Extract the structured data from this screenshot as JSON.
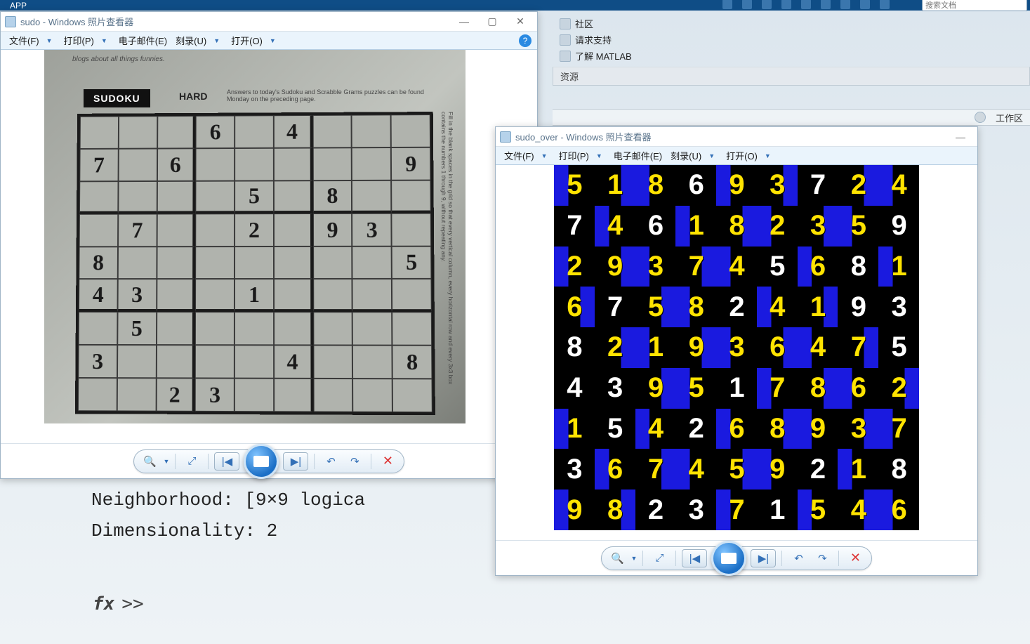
{
  "app_tab": "APP",
  "search_placeholder": "搜索文档",
  "matlab": {
    "links": [
      "社区",
      "请求支持",
      "了解 MATLAB"
    ],
    "resources_label": "资源",
    "workspace_label": "工作区",
    "console_line1": "Neighborhood: [9×9 logica",
    "console_line2": "Dimensionality: 2",
    "prompt_fx": "fx",
    "prompt": ">>"
  },
  "viewer1": {
    "title": "sudo - Windows 照片查看器",
    "menu": {
      "file": "文件(F)",
      "print": "打印(P)",
      "email": "电子邮件(E)",
      "burn": "刻录(U)",
      "open": "打开(O)"
    },
    "newspaper": {
      "blurb": "blogs about all things funnies.",
      "sudoku_label": "SUDOKU",
      "hard": "HARD",
      "note": "Answers to today's Sudoku and Scrabble Grams puzzles can be found Monday on the preceding page.",
      "side": "Fill in the blank spaces in the grid so that every vertical column, every horizontal row and every 3x3 box contains the numbers 1 through 9, without repeating any."
    }
  },
  "viewer2": {
    "title": "sudo_over - Windows 照片查看器",
    "menu": {
      "file": "文件(F)",
      "print": "打印(P)",
      "email": "电子邮件(E)",
      "burn": "刻录(U)",
      "open": "打开(O)"
    }
  },
  "sudoku_puzzle": [
    [
      "",
      "",
      "",
      "6",
      "",
      "4",
      "",
      "",
      ""
    ],
    [
      "7",
      "",
      "6",
      "",
      "",
      "",
      "",
      "",
      "9"
    ],
    [
      "",
      "",
      "",
      "",
      "5",
      "",
      "8",
      "",
      ""
    ],
    [
      "",
      "7",
      "",
      "",
      "2",
      "",
      "9",
      "3",
      ""
    ],
    [
      "8",
      "",
      "",
      "",
      "",
      "",
      "",
      "",
      "5"
    ],
    [
      "4",
      "3",
      "",
      "",
      "1",
      "",
      "",
      "",
      ""
    ],
    [
      "",
      "5",
      "",
      "",
      "",
      "",
      "",
      "",
      ""
    ],
    [
      "3",
      "",
      "",
      "",
      "",
      "4",
      "",
      "",
      "8"
    ],
    [
      "",
      "",
      "2",
      "3",
      "",
      "",
      "",
      "",
      ""
    ]
  ],
  "sudoku_solution": [
    [
      {
        "v": "5",
        "g": 0
      },
      {
        "v": "1",
        "g": 0
      },
      {
        "v": "8",
        "g": 0
      },
      {
        "v": "6",
        "g": 1
      },
      {
        "v": "9",
        "g": 0
      },
      {
        "v": "3",
        "g": 0
      },
      {
        "v": "7",
        "g": 1
      },
      {
        "v": "2",
        "g": 0
      },
      {
        "v": "4",
        "g": 0
      }
    ],
    [
      {
        "v": "7",
        "g": 1
      },
      {
        "v": "4",
        "g": 0
      },
      {
        "v": "6",
        "g": 1
      },
      {
        "v": "1",
        "g": 0
      },
      {
        "v": "8",
        "g": 0
      },
      {
        "v": "2",
        "g": 0
      },
      {
        "v": "3",
        "g": 0
      },
      {
        "v": "5",
        "g": 0
      },
      {
        "v": "9",
        "g": 1
      }
    ],
    [
      {
        "v": "2",
        "g": 0
      },
      {
        "v": "9",
        "g": 0
      },
      {
        "v": "3",
        "g": 0
      },
      {
        "v": "7",
        "g": 0
      },
      {
        "v": "4",
        "g": 0
      },
      {
        "v": "5",
        "g": 1
      },
      {
        "v": "6",
        "g": 0
      },
      {
        "v": "8",
        "g": 1
      },
      {
        "v": "1",
        "g": 0
      }
    ],
    [
      {
        "v": "6",
        "g": 0
      },
      {
        "v": "7",
        "g": 1
      },
      {
        "v": "5",
        "g": 0
      },
      {
        "v": "8",
        "g": 0
      },
      {
        "v": "2",
        "g": 1
      },
      {
        "v": "4",
        "g": 0
      },
      {
        "v": "1",
        "g": 0
      },
      {
        "v": "9",
        "g": 1
      },
      {
        "v": "3",
        "g": 1
      }
    ],
    [
      {
        "v": "8",
        "g": 1
      },
      {
        "v": "2",
        "g": 0
      },
      {
        "v": "1",
        "g": 0
      },
      {
        "v": "9",
        "g": 0
      },
      {
        "v": "3",
        "g": 0
      },
      {
        "v": "6",
        "g": 0
      },
      {
        "v": "4",
        "g": 0
      },
      {
        "v": "7",
        "g": 0
      },
      {
        "v": "5",
        "g": 1
      }
    ],
    [
      {
        "v": "4",
        "g": 1
      },
      {
        "v": "3",
        "g": 1
      },
      {
        "v": "9",
        "g": 0
      },
      {
        "v": "5",
        "g": 0
      },
      {
        "v": "1",
        "g": 1
      },
      {
        "v": "7",
        "g": 0
      },
      {
        "v": "8",
        "g": 0
      },
      {
        "v": "6",
        "g": 0
      },
      {
        "v": "2",
        "g": 0
      }
    ],
    [
      {
        "v": "1",
        "g": 0
      },
      {
        "v": "5",
        "g": 1
      },
      {
        "v": "4",
        "g": 0
      },
      {
        "v": "2",
        "g": 1
      },
      {
        "v": "6",
        "g": 0
      },
      {
        "v": "8",
        "g": 0
      },
      {
        "v": "9",
        "g": 0
      },
      {
        "v": "3",
        "g": 0
      },
      {
        "v": "7",
        "g": 0
      }
    ],
    [
      {
        "v": "3",
        "g": 1
      },
      {
        "v": "6",
        "g": 0
      },
      {
        "v": "7",
        "g": 0
      },
      {
        "v": "4",
        "g": 0
      },
      {
        "v": "5",
        "g": 0
      },
      {
        "v": "9",
        "g": 0
      },
      {
        "v": "2",
        "g": 1
      },
      {
        "v": "1",
        "g": 0
      },
      {
        "v": "8",
        "g": 1
      }
    ],
    [
      {
        "v": "9",
        "g": 0
      },
      {
        "v": "8",
        "g": 0
      },
      {
        "v": "2",
        "g": 1
      },
      {
        "v": "3",
        "g": 1
      },
      {
        "v": "7",
        "g": 0
      },
      {
        "v": "1",
        "g": 1
      },
      {
        "v": "5",
        "g": 0
      },
      {
        "v": "4",
        "g": 0
      },
      {
        "v": "6",
        "g": 0
      }
    ]
  ]
}
